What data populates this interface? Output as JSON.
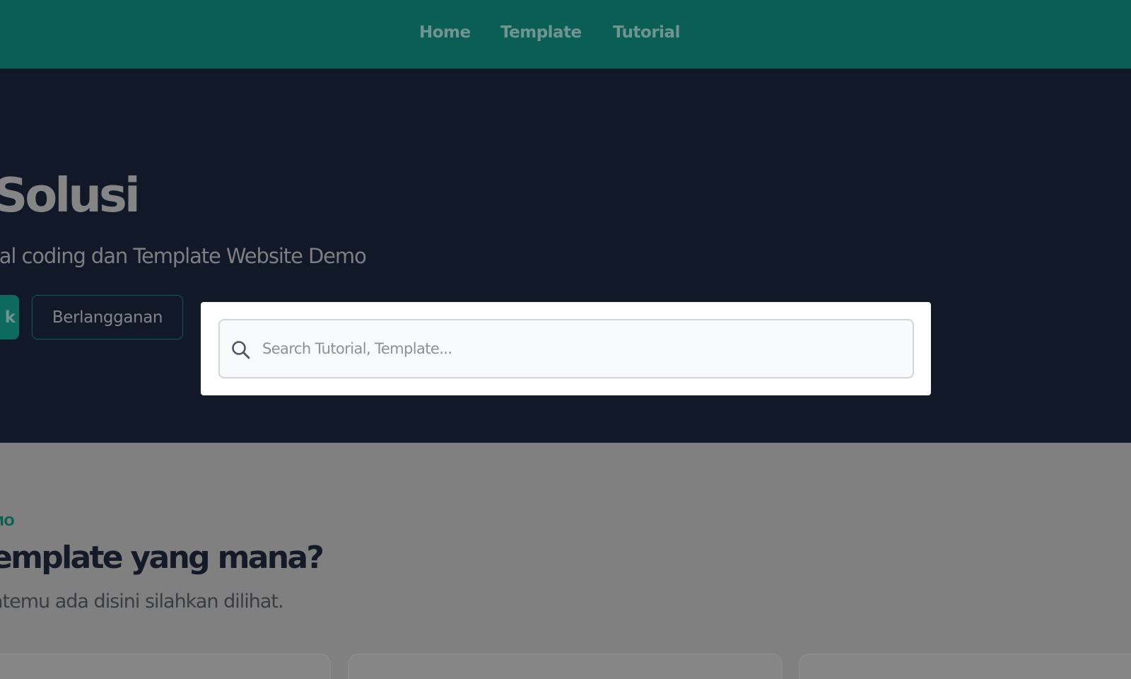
{
  "nav": {
    "items": [
      "Home",
      "Template",
      "Tutorial"
    ],
    "background": "#0b5e55"
  },
  "hero": {
    "title": "u Solusi",
    "subtitle": "torial coding dan Template Website Demo",
    "primary_button": "k",
    "secondary_button": "Berlangganan",
    "background": "#111827"
  },
  "section": {
    "tag": "MO",
    "title": "emplate yang mana?",
    "description": "atemu ada disini silahkan dilihat.",
    "cards": 3
  },
  "search": {
    "placeholder": "Search Tutorial, Template...",
    "value": "",
    "icon": "search-icon"
  },
  "colors": {
    "accent": "#0b5e55",
    "overlay": "#808080",
    "modal": "#ffffff"
  }
}
